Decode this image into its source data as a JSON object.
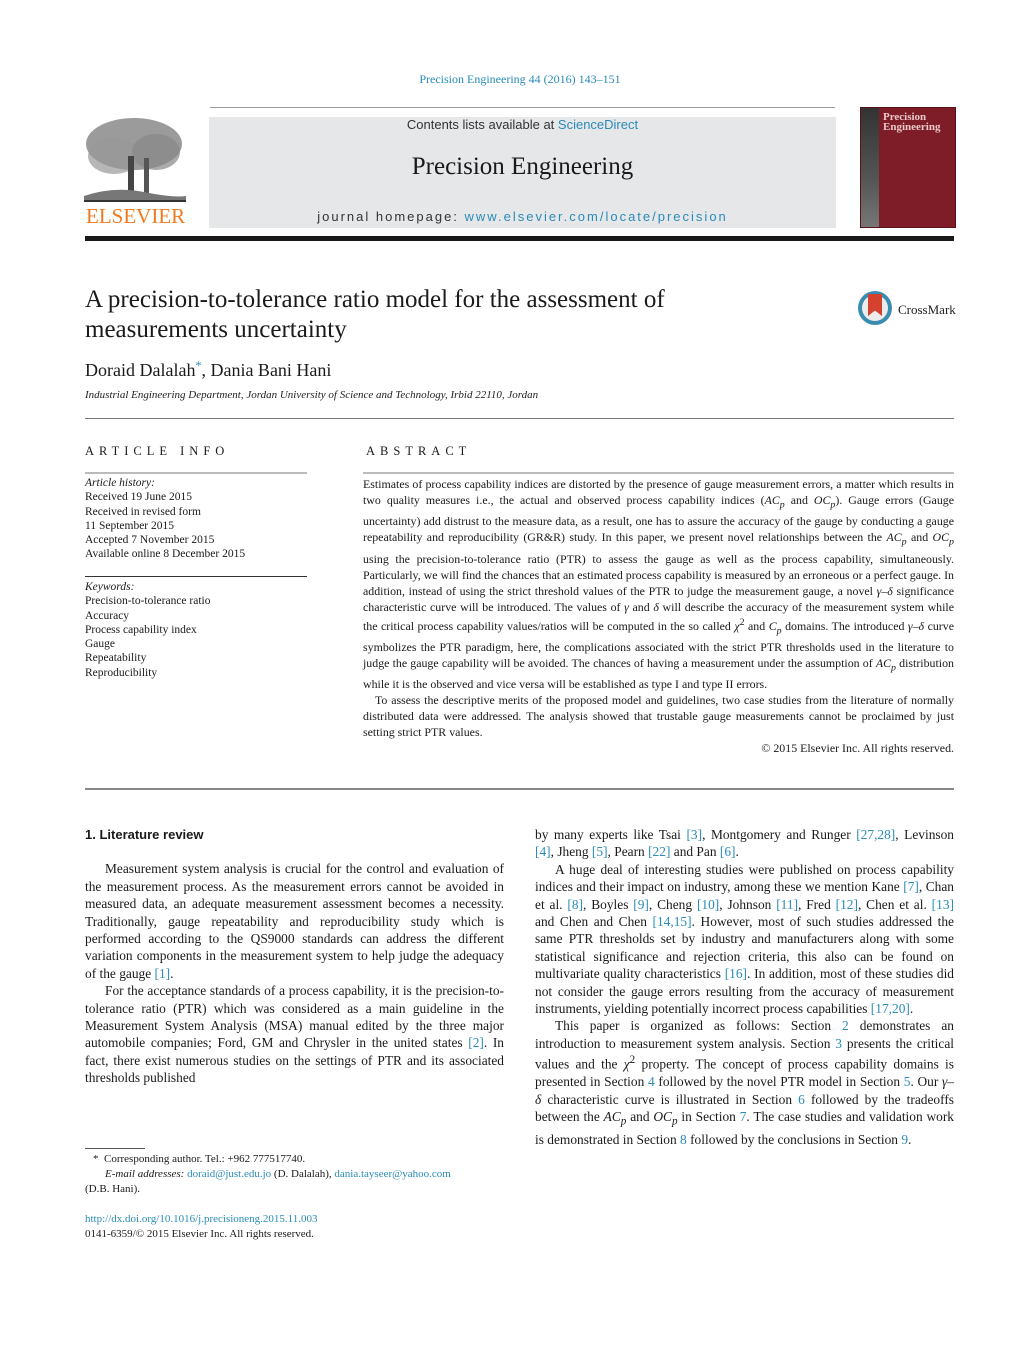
{
  "header": {
    "journal_ref": "Precision Engineering 44 (2016) 143–151",
    "contents_prefix": "Contents lists available at ",
    "contents_link": "ScienceDirect",
    "journal_title": "Precision Engineering",
    "homepage_prefix": "journal homepage: ",
    "homepage_link": "www.elsevier.com/locate/precision",
    "publisher_logo_text": "ELSEVIER",
    "cover_title_line1": "Precision",
    "cover_title_line2": "Engineering",
    "colors": {
      "link": "#2a8bb8",
      "elsevier_orange": "#f07a1f",
      "cover_red": "#7e1d27",
      "banner_gray": "#e6e7e8"
    }
  },
  "article": {
    "title": "A precision-to-tolerance ratio model for the assessment of measurements uncertainty",
    "crossmark_label": "CrossMark",
    "authors": [
      {
        "name": "Doraid Dalalah",
        "mark": "*"
      },
      {
        "name": "Dania Bani Hani",
        "mark": ""
      }
    ],
    "author_separator": ", ",
    "affiliation": "Industrial Engineering Department, Jordan University of Science and Technology, Irbid 22110, Jordan"
  },
  "article_info": {
    "heading": "ARTICLE INFO",
    "history_label": "Article history:",
    "history": [
      "Received 19 June 2015",
      "Received in revised form",
      "11 September 2015",
      "Accepted 7 November 2015",
      "Available online 8 December 2015"
    ],
    "keywords_label": "Keywords:",
    "keywords": [
      "Precision-to-tolerance ratio",
      "Accuracy",
      "Process capability index",
      "Gauge",
      "Repeatability",
      "Reproducibility"
    ]
  },
  "abstract": {
    "heading": "ABSTRACT",
    "p1": [
      "Estimates of process capability indices are distorted by the presence of gauge measurement errors, a matter which results in two quality measures i.e., the actual and observed process capability indices (",
      "AC",
      "p",
      " and ",
      "OC",
      "p",
      "). Gauge errors (Gauge uncertainty) add distrust to the measure data, as a result, one has to assure the accuracy of the gauge by conducting a gauge repeatability and reproducibility (GR&R) study. In this paper, we present novel relationships between the ",
      "AC",
      "p",
      " and ",
      "OC",
      "p",
      " using the precision-to-tolerance ratio (PTR) to assess the gauge as well as the process capability, simultaneously. Particularly, we will find the chances that an estimated process capability is measured by an erroneous or a perfect gauge. In addition, instead of using the strict threshold values of the PTR to judge the measurement gauge, a novel ",
      "γ–δ",
      " significance characteristic curve will be introduced. The values of ",
      "γ",
      " and ",
      "δ",
      " will describe the accuracy of the measurement system while the critical process capability values/ratios will be computed in the so called ",
      "χ",
      "2",
      " and ",
      "C",
      "p",
      " domains. The introduced ",
      "γ–δ",
      " curve symbolizes the PTR paradigm, here, the complications associated with the strict PTR thresholds used in the literature to judge the gauge capability will be avoided. The chances of having a measurement under the assumption of ",
      "AC",
      "p",
      " distribution while it is the observed and vice versa will be established as type I and type II errors."
    ],
    "p2": "To assess the descriptive merits of the proposed model and guidelines, two case studies from the literature of normally distributed data were addressed. The analysis showed that trustable gauge measurements cannot be proclaimed by just setting strict PTR values.",
    "copyright": "© 2015 Elsevier Inc. All rights reserved."
  },
  "body": {
    "section1_heading": "1.  Literature review",
    "left_p1": [
      "Measurement system analysis is crucial for the control and evaluation of the measurement process. As the measurement errors cannot be avoided in measured data, an adequate measurement assessment becomes a necessity. Traditionally, gauge repeatability and reproducibility study which is performed according to the QS9000 standards can address the different variation components in the measurement system to help judge the adequacy of the gauge ",
      "[1]",
      "."
    ],
    "left_p2": [
      "For the acceptance standards of a process capability, it is the precision-to-tolerance ratio (PTR) which was considered as a main guideline in the Measurement System Analysis (MSA) manual edited by the three major automobile companies; Ford, GM and Chrysler in the united states ",
      "[2]",
      ". In fact, there exist numerous studies on the settings of PTR and its associated thresholds published"
    ],
    "right_p1": [
      "by many experts like Tsai ",
      "[3]",
      ", Montgomery and Runger ",
      "[27,28]",
      ", Levinson ",
      "[4]",
      ", Jheng ",
      "[5]",
      ", Pearn ",
      "[22]",
      " and Pan ",
      "[6]",
      "."
    ],
    "right_p2": [
      "A huge deal of interesting studies were published on process capability indices and their impact on industry, among these we mention Kane ",
      "[7]",
      ", Chan et al. ",
      "[8]",
      ", Boyles ",
      "[9]",
      ", Cheng ",
      "[10]",
      ", Johnson ",
      "[11]",
      ", Fred ",
      "[12]",
      ", Chen et al. ",
      "[13]",
      " and Chen and Chen ",
      "[14,15]",
      ". However, most of such studies addressed the same PTR thresholds set by industry and manufacturers along with some statistical significance and rejection criteria, this also can be found on multivariate quality characteristics ",
      "[16]",
      ". In addition, most of these studies did not consider the gauge errors resulting from the accuracy of measurement instruments, yielding potentially incorrect process capabilities ",
      "[17,20]",
      "."
    ],
    "right_p3": [
      "This paper is organized as follows: Section ",
      "2",
      " demonstrates an introduction to measurement system analysis. Section ",
      "3",
      " presents the critical values and the ",
      "χ",
      "2",
      " property. The concept of process capability domains is presented in Section ",
      "4",
      " followed by the novel PTR model in Section ",
      "5",
      ". Our ",
      "γ–δ",
      " characteristic curve is illustrated in Section ",
      "6",
      " followed by the tradeoffs between the ",
      "AC",
      "p",
      " and ",
      "OC",
      "p",
      " in Section ",
      "7",
      ". The case studies and validation work is demonstrated in Section ",
      "8",
      " followed by the conclusions in Section ",
      "9",
      "."
    ]
  },
  "footnote": {
    "star": "*",
    "corresponding": "Corresponding author. Tel.: +962 777517740.",
    "email_label": "E-mail addresses:",
    "email1": "doraid@just.edu.jo",
    "email1_owner": " (D. Dalalah), ",
    "email2": "dania.tayseer@yahoo.com",
    "email2_owner": "(D.B. Hani).",
    "doi": "http://dx.doi.org/10.1016/j.precisioneng.2015.11.003",
    "issn": "0141-6359/© 2015 Elsevier Inc. All rights reserved."
  }
}
